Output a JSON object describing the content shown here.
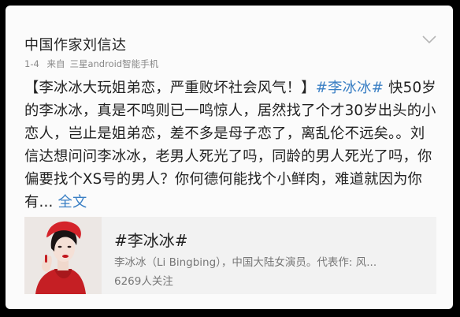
{
  "post": {
    "author": "中国作家刘信达",
    "time": "1-4",
    "source_prefix": "来自",
    "source": "三星android智能手机",
    "text_open_bracket": "【",
    "text_headline": "李冰冰大玩姐弟恋，严重败坏社会风气！",
    "text_close_bracket": "】",
    "hashtag": "#李冰冰#",
    "text_body": " 快50岁的李冰冰，真是不鸣则已一鸣惊人，居然找了个才30岁出头的小恋人，岂止是姐弟恋，差不多是母子恋了，离乱伦不远矣。。刘信达想问问李冰冰，老男人死光了吗，同龄的男人死光了吗，你偏要找个XS号的男人？你何德何能找个小鲜肉，难道就因为你有...",
    "full_text_label": " 全文"
  },
  "link_card": {
    "title": "#李冰冰#",
    "description": "李冰冰（Li Bingbing），中国大陆女演员。代表作: 风...",
    "followers": "6269人关注"
  },
  "icons": {
    "expand": "chevron-down-icon",
    "thumbnail": "portrait-photo"
  },
  "colors": {
    "link": "#3a7fc4",
    "background": "#000000",
    "card": "#fbfbfb"
  }
}
